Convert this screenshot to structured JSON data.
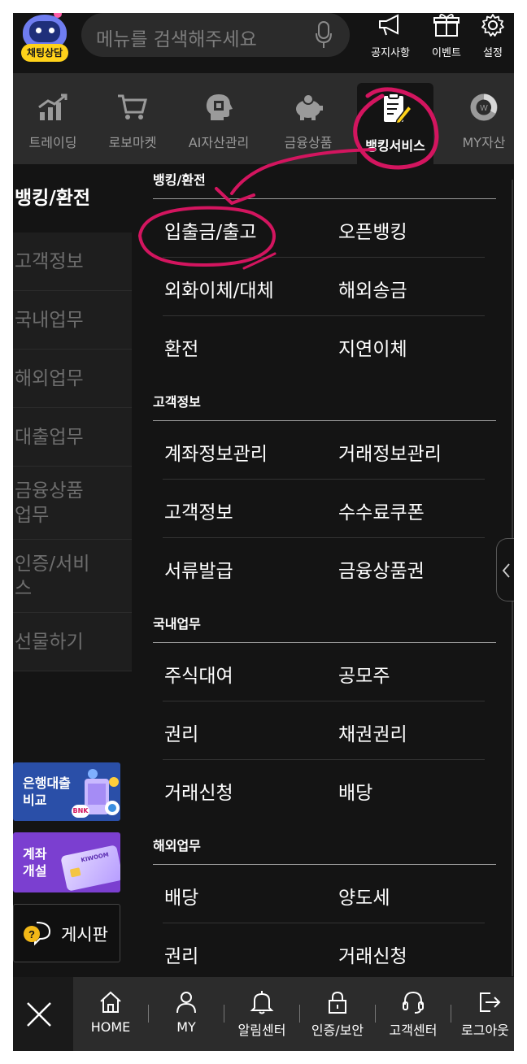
{
  "colors": {
    "accent_annotation": "#d3155f",
    "background": "#141414",
    "tab_bar": "#2c2c2c",
    "badge_yellow": "#ffd21a"
  },
  "header": {
    "chat_badge": "채팅상담",
    "search_placeholder": "메뉴를 검색해주세요",
    "tools": [
      {
        "label": "공지사항",
        "icon": "megaphone-icon"
      },
      {
        "label": "이벤트",
        "icon": "gift-icon"
      },
      {
        "label": "설정",
        "icon": "gear-icon"
      }
    ]
  },
  "categories": [
    {
      "label": "트레이딩",
      "icon": "chart-icon"
    },
    {
      "label": "로보마켓",
      "icon": "cart-icon"
    },
    {
      "label": "AI자산관리",
      "icon": "ai-head-icon"
    },
    {
      "label": "금융상품",
      "icon": "piggy-bank-icon"
    },
    {
      "label": "뱅킹서비스",
      "icon": "document-pen-icon",
      "active": true
    },
    {
      "label": "MY자산",
      "icon": "donut-chart-icon"
    }
  ],
  "side_menu": [
    {
      "label": "뱅킹/환전",
      "active": true
    },
    {
      "label": "고객정보"
    },
    {
      "label": "국내업무"
    },
    {
      "label": "해외업무"
    },
    {
      "label": "대출업무"
    },
    {
      "label": "금융상품업무",
      "line1": "금융상품",
      "line2": "업무"
    },
    {
      "label": "인증/서비스",
      "line1": "인증/서비",
      "line2": "스"
    },
    {
      "label": "선물하기"
    }
  ],
  "promos": {
    "loan": {
      "line1": "은행대출",
      "line2": "비교",
      "logo_text": "BNK"
    },
    "account": {
      "line1": "계좌",
      "line2": "개설",
      "card_text": "KIWOOM"
    },
    "board": "게시판"
  },
  "sections": [
    {
      "title": "뱅킹/환전",
      "rows": [
        [
          "입출금/출고",
          "오픈뱅킹"
        ],
        [
          "외화이체/대체",
          "해외송금"
        ],
        [
          "환전",
          "지연이체"
        ]
      ]
    },
    {
      "title": "고객정보",
      "rows": [
        [
          "계좌정보관리",
          "거래정보관리"
        ],
        [
          "고객정보",
          "수수료쿠폰"
        ],
        [
          "서류발급",
          "금융상품권"
        ]
      ]
    },
    {
      "title": "국내업무",
      "rows": [
        [
          "주식대여",
          "공모주"
        ],
        [
          "권리",
          "채권권리"
        ],
        [
          "거래신청",
          "배당"
        ]
      ]
    },
    {
      "title": "해외업무",
      "rows": [
        [
          "배당",
          "양도세"
        ],
        [
          "권리",
          "거래신청"
        ]
      ]
    }
  ],
  "bottom_nav": [
    {
      "label": "HOME",
      "icon": "home-icon"
    },
    {
      "label": "MY",
      "icon": "person-icon"
    },
    {
      "label": "알림센터",
      "icon": "bell-icon"
    },
    {
      "label": "인증/보안",
      "icon": "lock-icon"
    },
    {
      "label": "고객센터",
      "icon": "headset-icon"
    },
    {
      "label": "로그아웃",
      "icon": "logout-icon"
    }
  ]
}
